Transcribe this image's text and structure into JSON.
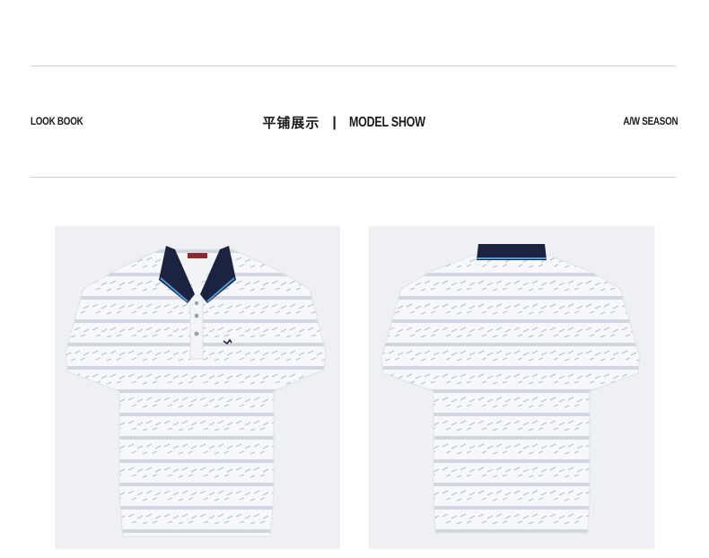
{
  "header": {
    "left_label": "LOOK BOOK",
    "center_cn": "平铺展示",
    "center_sep": "|",
    "center_en": "MODEL SHOW",
    "right_label": "A/W SEASON"
  },
  "images": [
    {
      "view": "front",
      "description_icon": "polo-shirt-front-icon"
    },
    {
      "view": "back",
      "description_icon": "polo-shirt-back-icon"
    }
  ],
  "colors": {
    "collar": "#1c2340",
    "collar_trim": "#4a9bd8",
    "shirt": "#f7f8fb",
    "stripe": "#c9cdd6",
    "background": "#eef0f3"
  }
}
